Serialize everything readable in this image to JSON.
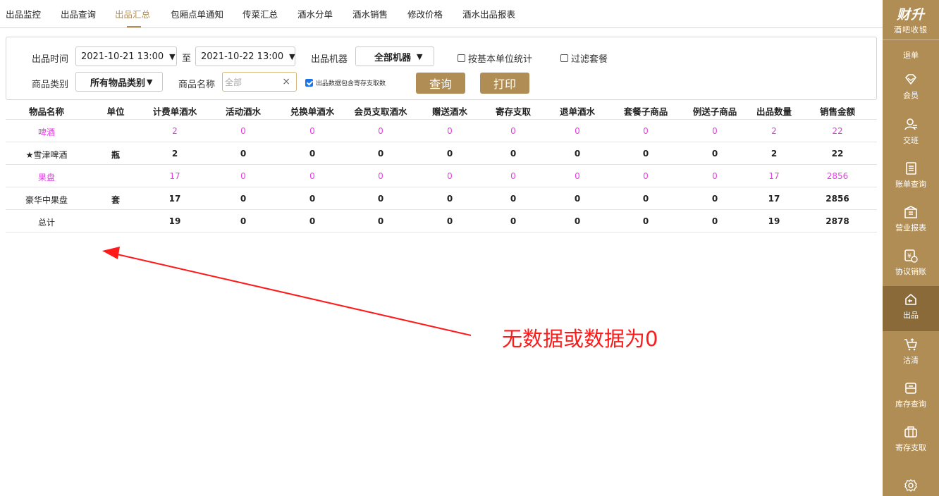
{
  "tabs": [
    "出品监控",
    "出品查询",
    "出品汇总",
    "包厢点单通知",
    "传菜汇总",
    "酒水分单",
    "酒水销售",
    "修改价格",
    "酒水出品报表"
  ],
  "active_tab_index": 2,
  "filters": {
    "time_label": "出品时间",
    "start_time": "2021-10-21 13:00",
    "to_label": "至",
    "end_time": "2021-10-22 13:00",
    "machine_label": "出品机器",
    "machine_value": "全部机器",
    "basic_unit_label": "按基本单位统计",
    "filter_package_label": "过滤套餐",
    "category_label": "商品类别",
    "category_value": "所有物品类别",
    "name_label": "商品名称",
    "name_placeholder": "全部",
    "clear_symbol": "×",
    "include_storage_label": "出品数据包含寄存支取数",
    "query_button": "查询",
    "print_button": "打印"
  },
  "table": {
    "headers": [
      "物品名称",
      "单位",
      "计费单酒水",
      "活动酒水",
      "兑换单酒水",
      "会员支取酒水",
      "赠送酒水",
      "寄存支取",
      "退单酒水",
      "套餐子商品",
      "例送子商品",
      "出品数量",
      "销售金额"
    ],
    "rows": [
      {
        "type": "cat",
        "cells": [
          "啤酒",
          "",
          "2",
          "0",
          "0",
          "0",
          "0",
          "0",
          "0",
          "0",
          "0",
          "2",
          "22"
        ]
      },
      {
        "type": "item",
        "cells": [
          "★雪津啤酒",
          "瓶",
          "2",
          "0",
          "0",
          "0",
          "0",
          "0",
          "0",
          "0",
          "0",
          "2",
          "22"
        ]
      },
      {
        "type": "cat",
        "cells": [
          "果盘",
          "",
          "17",
          "0",
          "0",
          "0",
          "0",
          "0",
          "0",
          "0",
          "0",
          "17",
          "2856"
        ]
      },
      {
        "type": "item",
        "cells": [
          "豪华中果盘",
          "套",
          "17",
          "0",
          "0",
          "0",
          "0",
          "0",
          "0",
          "0",
          "0",
          "17",
          "2856"
        ]
      },
      {
        "type": "total",
        "cells": [
          "总计",
          "",
          "19",
          "0",
          "0",
          "0",
          "0",
          "0",
          "0",
          "0",
          "0",
          "19",
          "2878"
        ]
      }
    ]
  },
  "annotation": "无数据或数据为0",
  "sidebar": {
    "brand": "财升",
    "subtitle": "酒吧收银",
    "items": [
      {
        "label": "退单",
        "icon": "refund-icon"
      },
      {
        "label": "会员",
        "icon": "diamond-icon"
      },
      {
        "label": "交班",
        "icon": "handover-icon"
      },
      {
        "label": "账单查询",
        "icon": "bill-icon"
      },
      {
        "label": "营业报表",
        "icon": "report-icon"
      },
      {
        "label": "协议销账",
        "icon": "agreement-icon"
      },
      {
        "label": "出品",
        "icon": "output-icon"
      },
      {
        "label": "沽清",
        "icon": "cart-icon"
      },
      {
        "label": "库存查询",
        "icon": "inventory-icon"
      },
      {
        "label": "寄存支取",
        "icon": "storage-icon"
      },
      {
        "label": "",
        "icon": "gear-icon"
      }
    ],
    "active_index": 6
  },
  "colors": {
    "accent": "#b08d55",
    "category_text": "#e63ee6",
    "annotation": "#ff1a1a"
  }
}
